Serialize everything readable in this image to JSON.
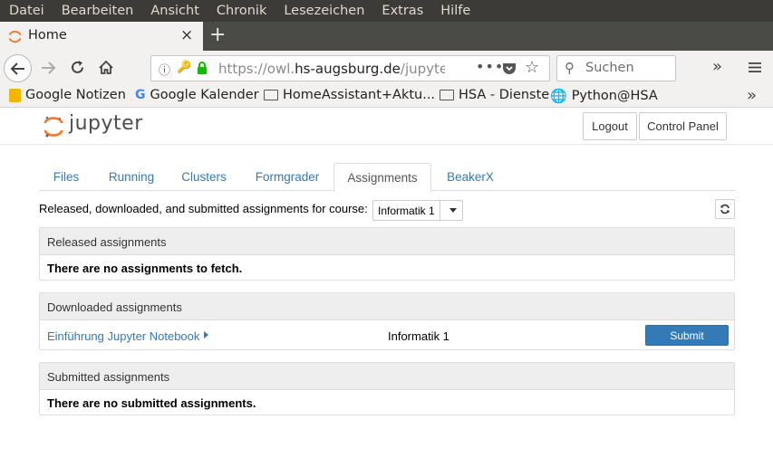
{
  "menu": [
    "Datei",
    "Bearbeiten",
    "Ansicht",
    "Chronik",
    "Lesezeichen",
    "Extras",
    "Hilfe"
  ],
  "tab": {
    "title": "Home",
    "close": "×",
    "new": "+"
  },
  "urlbar": {
    "url_prefix": "https://owl.",
    "url_domain": "hs-augsburg.de",
    "url_suffix": "/jupyter/u",
    "dots": "•••"
  },
  "search": {
    "placeholder": "Suchen"
  },
  "bookmarks": [
    "Google Notizen",
    "Google Kalender",
    "HomeAssistant+Aktu...",
    "HSA - Dienste",
    "Python@HSA"
  ],
  "header": {
    "logo_text": "jupyter",
    "logout": "Logout",
    "control_panel": "Control Panel"
  },
  "tabs": [
    "Files",
    "Running",
    "Clusters",
    "Formgrader",
    "Assignments",
    "BeakerX"
  ],
  "active_tab": "Assignments",
  "course_label": "Released, downloaded, and submitted assignments for course:",
  "course_select": "Informatik 1",
  "released": {
    "title": "Released assignments",
    "empty": "There are no assignments to fetch."
  },
  "downloaded": {
    "title": "Downloaded assignments",
    "items": [
      {
        "name": "Einführung Jupyter Notebook",
        "course": "Informatik 1",
        "action": "Submit"
      }
    ]
  },
  "submitted": {
    "title": "Submitted assignments",
    "empty": "There are no submitted assignments."
  },
  "colors": {
    "accent": "#337ab7",
    "menubar": "#3c3b37",
    "jupyter_orange": "#f37726"
  }
}
